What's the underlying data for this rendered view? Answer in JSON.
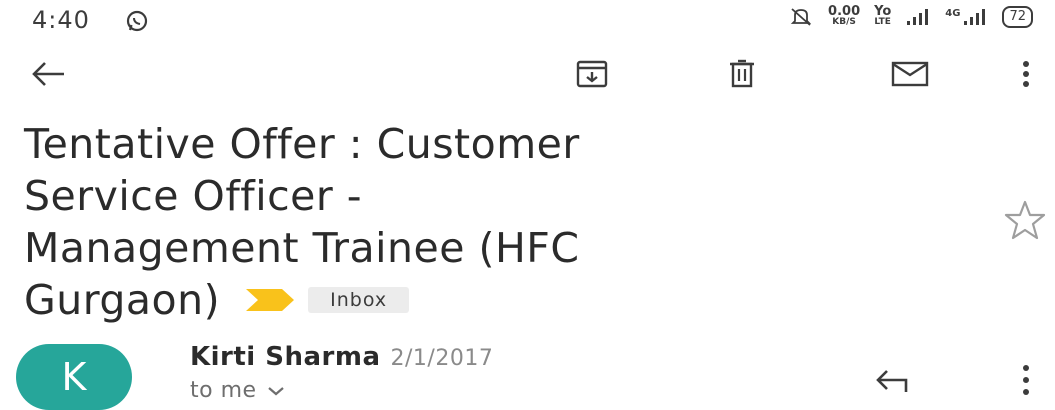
{
  "status_bar": {
    "time": "4:40",
    "net_speed_value": "0.00",
    "net_speed_unit": "KB/S",
    "volte_top": "Yo",
    "volte_bottom": "LTE",
    "network_4g": "4G",
    "battery": "72",
    "icons": [
      "whatsapp-icon",
      "mute-icon",
      "signal-icon",
      "signal-icon"
    ]
  },
  "toolbar": {
    "icons": [
      "back-arrow-icon",
      "archive-icon",
      "delete-icon",
      "mail-icon",
      "more-vert-icon"
    ]
  },
  "email": {
    "subject_lines": [
      "Tentative Offer : Customer",
      "Service Officer -",
      "Management Trainee (HFC",
      "Gurgaon)"
    ],
    "label": "Inbox",
    "sender_initial": "K",
    "sender_name": "Kirti Sharma",
    "date": "2/1/2017",
    "recipient": "to me",
    "colors": {
      "avatar": "#26a69a",
      "importance_marker": "#f9c21b"
    }
  }
}
